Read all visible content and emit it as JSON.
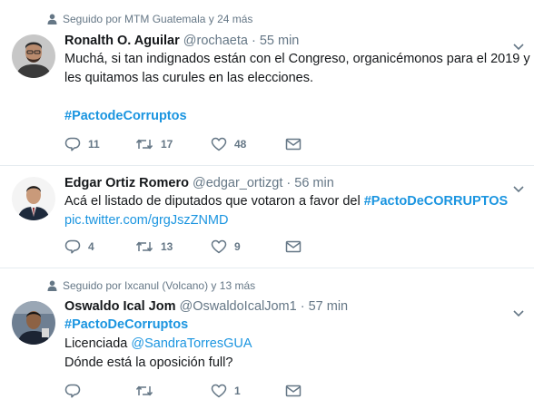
{
  "tweets": [
    {
      "social_context": "Seguido por MTM Guatemala y 24 más",
      "name": "Ronalth O. Aguilar",
      "handle": "@rochaeta",
      "dot": "·",
      "time": "55 min",
      "lines": [
        "Muchá, si tan indignados están con el Congreso, organicémonos para el 2019 y",
        "les quitamos las curules en las elecciones."
      ],
      "hashtag": "#PactodeCorruptos",
      "replies": "11",
      "retweets": "17",
      "likes": "48"
    },
    {
      "name": "Edgar Ortiz Romero",
      "handle": "@edgar_ortizgt",
      "dot": "·",
      "time": "56 min",
      "line1": "Acá el listado de diputados que votaron a favor del ",
      "hashtag": "#PactoDeCORRUPTOS",
      "link": "pic.twitter.com/grgJszZNMD",
      "replies": "4",
      "retweets": "13",
      "likes": "9"
    },
    {
      "social_context": "Seguido por Ixcanul (Volcano) y 13 más",
      "name": "Oswaldo Ical Jom",
      "handle": "@OswaldoIcalJom1",
      "dot": "·",
      "time": "57 min",
      "hashtag": "#PactoDeCorruptos",
      "line2_prefix": "Licenciada ",
      "mention": "@SandraTorresGUA",
      "line3": "Dónde está la oposición full?",
      "replies": "",
      "retweets": "",
      "likes": "1"
    }
  ],
  "icons": {
    "social": "person-icon",
    "reply": "reply-icon",
    "retweet": "retweet-icon",
    "like": "heart-icon",
    "dm": "envelope-icon",
    "caret": "chevron-down-icon"
  },
  "colors": {
    "link": "#1b95e0",
    "secondary_text": "#657786",
    "divider": "#e6ecf0"
  }
}
